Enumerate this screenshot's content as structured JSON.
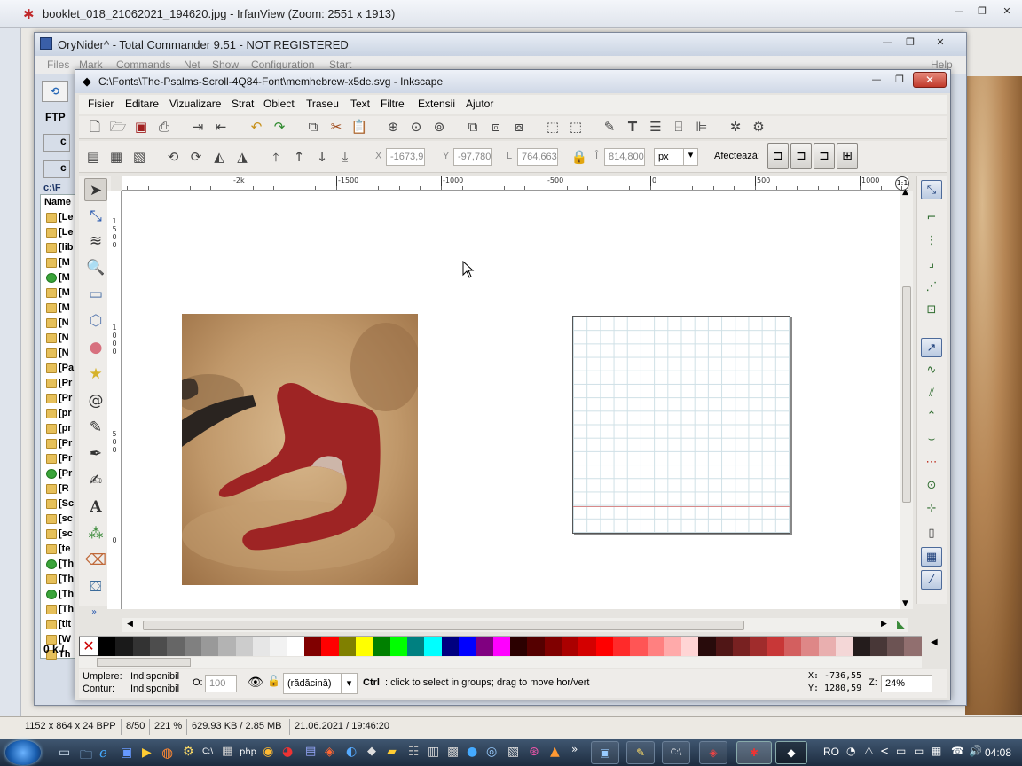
{
  "irfanview": {
    "title": "booklet_018_21062021_194620.jpg - IrfanView (Zoom: 2551 x 1913)",
    "status": [
      "1152 x 864 x 24 BPP",
      "8/50",
      "221 %",
      "629.93 KB / 2.85 MB",
      "21.06.2021 / 19:46:20"
    ]
  },
  "total_commander": {
    "title": "OryNider^ - Total Commander 9.51 - NOT REGISTERED",
    "menu": [
      "Files",
      "Mark",
      "Commands",
      "Net",
      "Show",
      "Configuration",
      "Start",
      "Help"
    ],
    "ftp_label": "FTP",
    "drive_label": "c",
    "path_label": "c:\\F",
    "column_header": "Name",
    "files": [
      "[Le",
      "[Le",
      "[lib",
      "[M",
      "[M",
      "[M",
      "[M",
      "[N",
      "[N",
      "[N",
      "[Pa",
      "[Pr",
      "[Pr",
      "[pr",
      "[pr",
      "[Pr",
      "[Pr",
      "[Pr",
      "[R",
      "[Sc",
      "[sc",
      "[sc",
      "[te",
      "[Th",
      "[Th",
      "[Th",
      "[Th",
      "[tit",
      "[W",
      "Th"
    ],
    "checked_rows": [
      4,
      17,
      23,
      25
    ],
    "free_space": "0 k / "
  },
  "inkscape": {
    "title": "C:\\Fonts\\The-Psalms-Scroll-4Q84-Font\\memhebrew-x5de.svg - Inkscape",
    "menu": [
      "Fisier",
      "Editare",
      "Vizualizare",
      "Strat",
      "Obiect",
      "Traseu",
      "Text",
      "Filtre",
      "Extensii",
      "Ajutor"
    ],
    "toolbar": {
      "x_label": "X",
      "x_value": "-1673,9",
      "y_label": "Y",
      "y_value": "-97,780",
      "w_label": "L",
      "w_value": "764,663",
      "h_label": "Î",
      "h_value": "814,800",
      "unit": "px",
      "affect_label": "Afectează:"
    },
    "ruler_labels": [
      "-2k",
      "-1500",
      "-1000",
      "-500",
      "0",
      "500",
      "1000"
    ],
    "vruler_labels": [
      "1500",
      "1000",
      "500",
      "0"
    ],
    "status": {
      "fill_label": "Umplere:",
      "fill_value": "Indisponibil",
      "stroke_label": "Contur:",
      "stroke_value": "Indisponibil",
      "opacity_label": "O:",
      "opacity_value": "100",
      "layer": "(rădăcină)",
      "hint_key": "Ctrl",
      "hint_text": ": click to select in groups; drag to move hor/vert",
      "x_coord": "X: -736,55",
      "y_coord": "Y: 1280,59",
      "zoom_label": "Z:",
      "zoom_value": "24%"
    },
    "palette": [
      "#000000",
      "#1a1a1a",
      "#333333",
      "#4d4d4d",
      "#666666",
      "#808080",
      "#999999",
      "#b3b3b3",
      "#cccccc",
      "#e6e6e6",
      "#f2f2f2",
      "#ffffff",
      "#800000",
      "#ff0000",
      "#808000",
      "#ffff00",
      "#008000",
      "#00ff00",
      "#008080",
      "#00ffff",
      "#000080",
      "#0000ff",
      "#800080",
      "#ff00ff",
      "#2b0000",
      "#550000",
      "#800000",
      "#aa0000",
      "#d40000",
      "#ff0000",
      "#ff2a2a",
      "#ff5555",
      "#ff8080",
      "#ffaaaa",
      "#ffd5d5",
      "#280b0b",
      "#501616",
      "#782121",
      "#a02c2c",
      "#c83737",
      "#d35f5f",
      "#de8787",
      "#e9afaf",
      "#f4d7d7",
      "#241c1c",
      "#483737",
      "#6c5353",
      "#916f6f"
    ],
    "glyph_color": "#9e2424"
  },
  "taskbar": {
    "lang": "RO",
    "clock": "04:08"
  }
}
